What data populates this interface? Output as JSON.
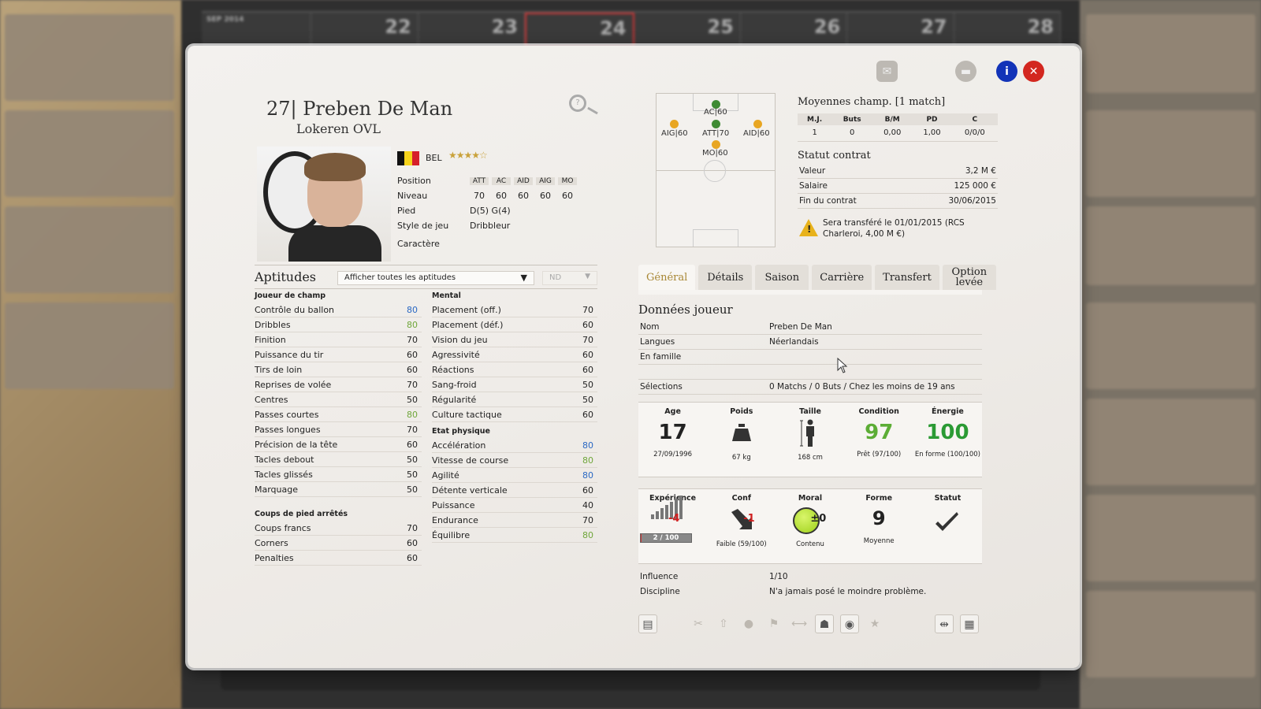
{
  "background": {
    "calendar_month": "SEP 2014",
    "calendar_days": [
      "22",
      "23",
      "24",
      "25",
      "26",
      "27",
      "28"
    ]
  },
  "player": {
    "number_name": "27| Preben De Man",
    "club": "Lokeren OVL",
    "nationality": "BEL",
    "stars": "★★★★☆"
  },
  "positions": {
    "label_position": "Position",
    "headers": [
      "ATT",
      "AC",
      "AID",
      "AIG",
      "MO"
    ],
    "label_niveau": "Niveau",
    "values": [
      "70",
      "60",
      "60",
      "60",
      "60"
    ],
    "label_pied": "Pied",
    "pied": "D(5) G(4)",
    "label_style": "Style de jeu",
    "style": "Dribbleur",
    "label_caractere": "Caractère"
  },
  "aptitudes": {
    "title": "Aptitudes",
    "filter": "Afficher toutes les aptitudes",
    "nd": "ND",
    "joueur_head": "Joueur de champ",
    "joueur": [
      {
        "name": "Contrôle du ballon",
        "value": "80",
        "color": "blue"
      },
      {
        "name": "Dribbles",
        "value": "80",
        "color": "green"
      },
      {
        "name": "Finition",
        "value": "70",
        "color": ""
      },
      {
        "name": "Puissance du tir",
        "value": "60",
        "color": ""
      },
      {
        "name": "Tirs de loin",
        "value": "60",
        "color": ""
      },
      {
        "name": "Reprises de volée",
        "value": "70",
        "color": ""
      },
      {
        "name": "Centres",
        "value": "50",
        "color": ""
      },
      {
        "name": "Passes courtes",
        "value": "80",
        "color": "green"
      },
      {
        "name": "Passes longues",
        "value": "70",
        "color": ""
      },
      {
        "name": "Précision de la tête",
        "value": "60",
        "color": ""
      },
      {
        "name": "Tacles debout",
        "value": "50",
        "color": ""
      },
      {
        "name": "Tacles glissés",
        "value": "50",
        "color": ""
      },
      {
        "name": "Marquage",
        "value": "50",
        "color": ""
      }
    ],
    "coups_head": "Coups de pied arrêtés",
    "coups": [
      {
        "name": "Coups francs",
        "value": "70",
        "color": ""
      },
      {
        "name": "Corners",
        "value": "60",
        "color": ""
      },
      {
        "name": "Penalties",
        "value": "60",
        "color": ""
      }
    ],
    "mental_head": "Mental",
    "mental": [
      {
        "name": "Placement (off.)",
        "value": "70",
        "color": ""
      },
      {
        "name": "Placement (déf.)",
        "value": "60",
        "color": ""
      },
      {
        "name": "Vision du jeu",
        "value": "70",
        "color": ""
      },
      {
        "name": "Agressivité",
        "value": "60",
        "color": ""
      },
      {
        "name": "Réactions",
        "value": "60",
        "color": ""
      },
      {
        "name": "Sang-froid",
        "value": "50",
        "color": ""
      },
      {
        "name": "Régularité",
        "value": "50",
        "color": ""
      },
      {
        "name": "Culture tactique",
        "value": "60",
        "color": ""
      }
    ],
    "physique_head": "Etat physique",
    "physique": [
      {
        "name": "Accélération",
        "value": "80",
        "color": "blue"
      },
      {
        "name": "Vitesse de course",
        "value": "80",
        "color": "green"
      },
      {
        "name": "Agilité",
        "value": "80",
        "color": "blue"
      },
      {
        "name": "Détente verticale",
        "value": "60",
        "color": ""
      },
      {
        "name": "Puissance",
        "value": "40",
        "color": ""
      },
      {
        "name": "Endurance",
        "value": "70",
        "color": ""
      },
      {
        "name": "Équilibre",
        "value": "80",
        "color": "green"
      }
    ]
  },
  "pitch": {
    "positions": [
      {
        "label": "AC|60",
        "color": "green"
      },
      {
        "label": "ATT|70",
        "color": "green"
      },
      {
        "label": "AIG|60",
        "color": "orange"
      },
      {
        "label": "AID|60",
        "color": "orange"
      },
      {
        "label": "MO|60",
        "color": "orange"
      }
    ]
  },
  "averages": {
    "title": "Moyennes champ. [1 match]",
    "headers": [
      "M.J.",
      "Buts",
      "B/M",
      "PD",
      "C"
    ],
    "values": [
      "1",
      "0",
      "0,00",
      "1,00",
      "0/0/0"
    ]
  },
  "contract": {
    "title": "Statut contrat",
    "rows": [
      {
        "k": "Valeur",
        "v": "3,2 M €"
      },
      {
        "k": "Salaire",
        "v": "125 000 €"
      },
      {
        "k": "Fin du contrat",
        "v": "30/06/2015"
      }
    ],
    "warning": "Sera transféré le 01/01/2015 (RCS Charleroi, 4,00 M €)"
  },
  "tabs": [
    "Général",
    "Détails",
    "Saison",
    "Carrière",
    "Transfert",
    "Option levée"
  ],
  "player_data": {
    "title": "Données joueur",
    "rows": [
      {
        "k": "Nom",
        "v": "Preben De Man"
      },
      {
        "k": "Langues",
        "v": "Néerlandais"
      },
      {
        "k": "En famille",
        "v": ""
      }
    ],
    "selections_k": "Sélections",
    "selections_v": "0 Matchs / 0 Buts / Chez les moins de 19 ans"
  },
  "stats1": {
    "age_h": "Age",
    "age": "17",
    "age_sub": "27/09/1996",
    "poids_h": "Poids",
    "poids_sub": "67 kg",
    "taille_h": "Taille",
    "taille_sub": "168 cm",
    "condition_h": "Condition",
    "condition": "97",
    "condition_sub": "Prêt (97/100)",
    "energie_h": "Énergie",
    "energie": "100",
    "energie_sub": "En forme (100/100)"
  },
  "stats2": {
    "exp_h": "Expérience",
    "exp_delta": "-4",
    "exp_bar": "2 / 100",
    "exp_fill": 0.02,
    "conf_h": "Conf",
    "conf_delta": "-1",
    "conf_sub": "Faible (59/100)",
    "moral_h": "Moral",
    "moral_delta": "±0",
    "moral_sub": "Contenu",
    "forme_h": "Forme",
    "forme": "9",
    "forme_sub": "Moyenne",
    "statut_h": "Statut"
  },
  "player_data2": {
    "rows": [
      {
        "k": "Influence",
        "v": "1/10"
      },
      {
        "k": "Discipline",
        "v": "N'a jamais posé le moindre problème."
      }
    ]
  },
  "colors": {
    "blue": "#2a68c3",
    "green": "#6fa63a",
    "accent_tab": "#a88734",
    "close": "#d3271f",
    "info": "#1233b8"
  }
}
